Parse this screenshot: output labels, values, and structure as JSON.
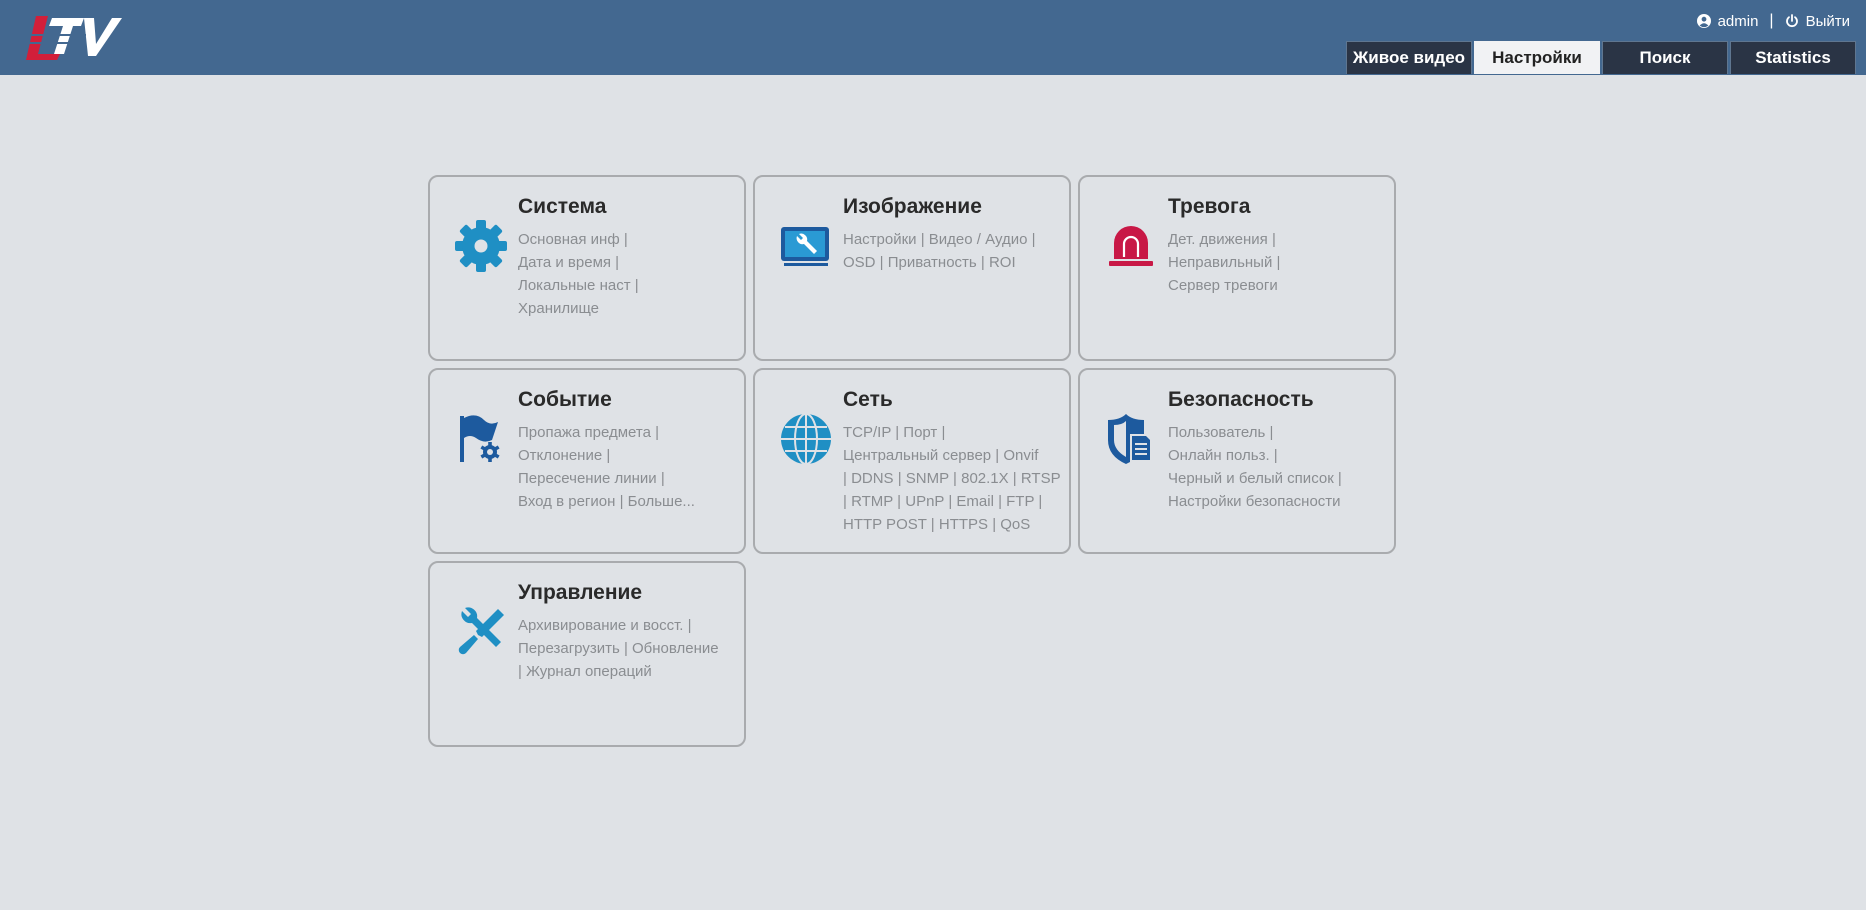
{
  "header": {
    "logo_text": "LTV",
    "user": "admin",
    "separator": "|",
    "logout": "Выйти",
    "tabs": [
      {
        "label": "Живое видео",
        "active": false
      },
      {
        "label": "Настройки",
        "active": true
      },
      {
        "label": "Поиск",
        "active": false
      },
      {
        "label": "Statistics",
        "active": false
      }
    ]
  },
  "cards": {
    "system": {
      "title": "Система",
      "icon": "gear-icon",
      "links": [
        "Основная инф |",
        "Дата и время |",
        "Локальные наст |",
        "Хранилище"
      ]
    },
    "image": {
      "title": "Изображение",
      "icon": "monitor-wrench-icon",
      "links": [
        "Настройки | Видео / Аудио |",
        "OSD | Приватность | ROI"
      ]
    },
    "alarm": {
      "title": "Тревога",
      "icon": "alarm-siren-icon",
      "links": [
        "Дет. движения |",
        "Неправильный |",
        "Сервер тревоги"
      ]
    },
    "event": {
      "title": "Событие",
      "icon": "flag-gear-icon",
      "links": [
        "Пропажа предмета |",
        "Отклонение |",
        "Пересечение линии |",
        "Вход в регион | Больше..."
      ]
    },
    "network": {
      "title": "Сеть",
      "icon": "globe-icon",
      "links": [
        "TCP/IP | Порт |",
        "Центральный сервер | Onvif",
        " | DDNS | SNMP | 802.1X | RTSP",
        " | RTMP | UPnP | Email | FTP |",
        "HTTP POST | HTTPS | QoS"
      ]
    },
    "security": {
      "title": "Безопасность",
      "icon": "shield-document-icon",
      "links": [
        "Пользователь |",
        "Онлайн польз. |",
        "Черный и белый список |",
        "Настройки безопасности"
      ]
    },
    "management": {
      "title": "Управление",
      "icon": "tools-icon",
      "links": [
        "Архивирование и восст.  |",
        "Перезагрузить | Обновление",
        " | Журнал операций"
      ]
    }
  },
  "colors": {
    "header_bg": "#436890",
    "page_bg": "#dfe2e6",
    "tab_bg": "#2a3445",
    "tab_active_bg": "#f1f2f4",
    "icon_blue": "#1f8fc4",
    "icon_dark_blue": "#1d5a9e",
    "icon_red": "#c81846",
    "logo_red": "#d21f3a"
  }
}
